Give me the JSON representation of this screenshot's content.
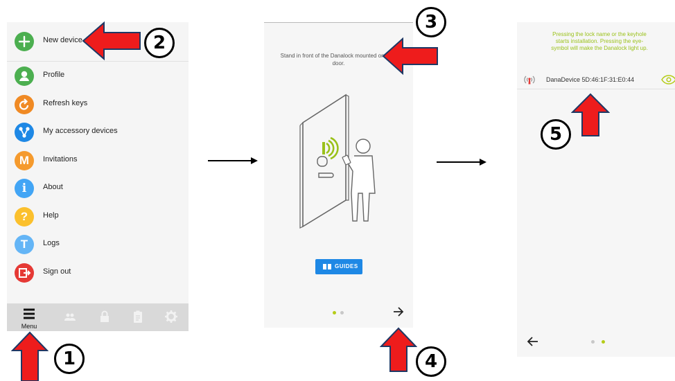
{
  "panel1": {
    "menu_items": [
      {
        "label": "New device",
        "icon": "plus-icon",
        "color": "#4caf50"
      },
      {
        "label": "Profile",
        "icon": "person-icon",
        "color": "#4caf50"
      },
      {
        "label": "Refresh keys",
        "icon": "refresh-icon",
        "color": "#f08a24"
      },
      {
        "label": "My accessory devices",
        "icon": "share-nodes-icon",
        "color": "#1e88e5"
      },
      {
        "label": "Invitations",
        "icon": "letter-m-icon",
        "color": "#f59a2d",
        "glyph": "M"
      },
      {
        "label": "About",
        "icon": "info-icon",
        "color": "#42a5f5",
        "glyph": "i"
      },
      {
        "label": "Help",
        "icon": "question-icon",
        "color": "#fbc02d",
        "glyph": "?"
      },
      {
        "label": "Logs",
        "icon": "letter-t-icon",
        "color": "#64b5f6",
        "glyph": "T"
      },
      {
        "label": "Sign out",
        "icon": "exit-icon",
        "color": "#e53935"
      }
    ],
    "tabbar": {
      "menu_label": "Menu",
      "tabs": [
        "menu-icon",
        "people-icon",
        "lock-icon",
        "clipboard-icon",
        "gear-icon"
      ]
    }
  },
  "panel2": {
    "instruction": "Stand in front of the Danalock mounted on your door.",
    "guides_label": "GUIDES",
    "page_indicator": {
      "pages": 2,
      "active": 1
    },
    "accent": "#1e88e5"
  },
  "panel3": {
    "info_text": "Pressing the lock name or the keyhole starts installation. Pressing the eye-symbol will make the Danalock light up.",
    "device_name": "DanaDevice 5D:46:1F:31:E0:44",
    "page_indicator": {
      "pages": 2,
      "active": 2
    },
    "accent": "#b5cc18"
  },
  "annotations": [
    "1",
    "2",
    "3",
    "4",
    "5"
  ]
}
